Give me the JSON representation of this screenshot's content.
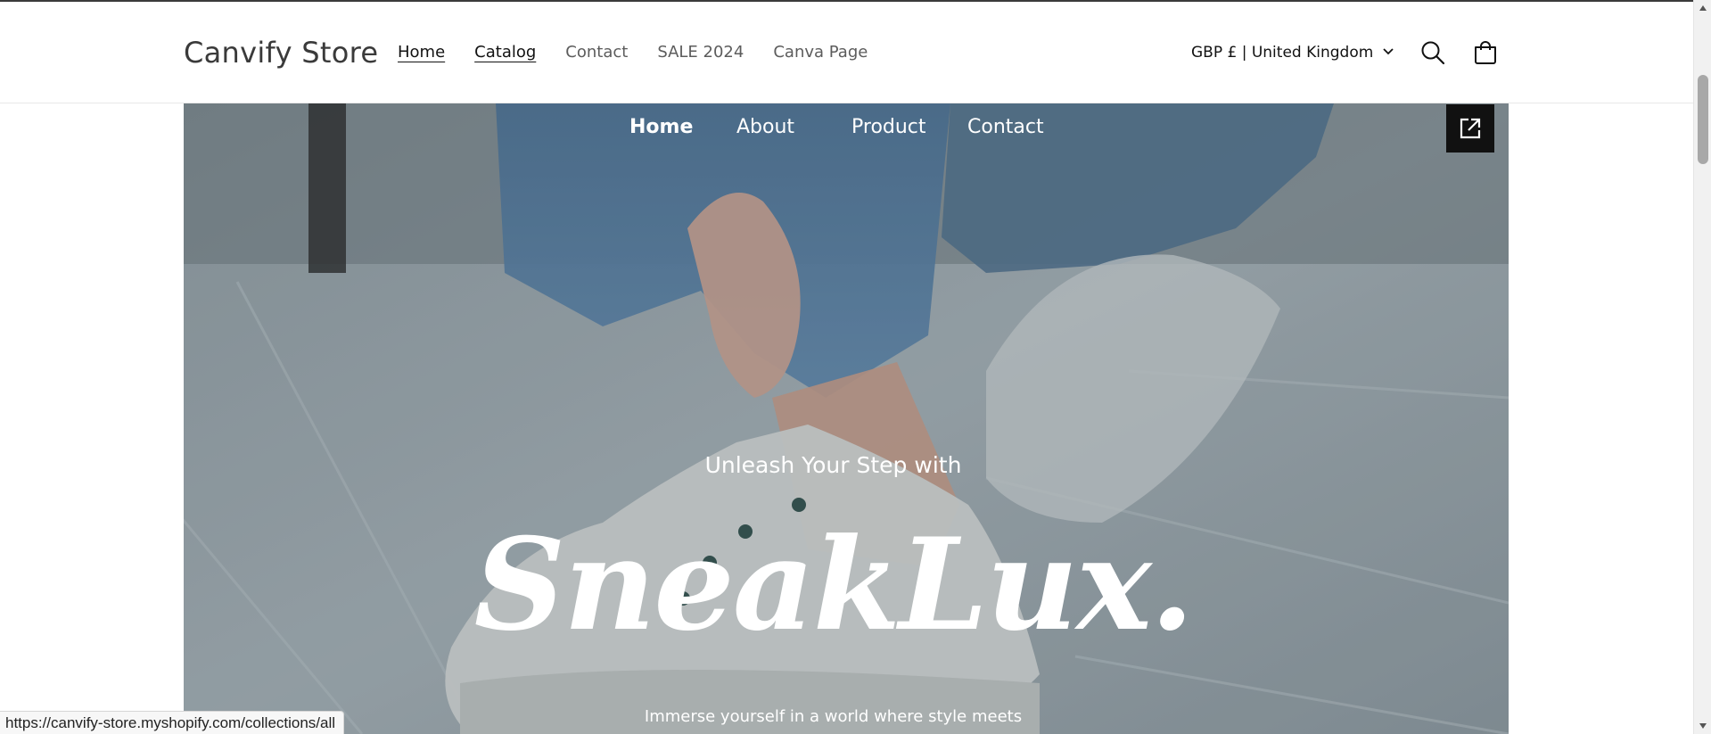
{
  "header": {
    "logo": "Canvify Store",
    "nav": [
      {
        "label": "Home",
        "active": true
      },
      {
        "label": "Catalog",
        "active": true
      },
      {
        "label": "Contact",
        "active": false
      },
      {
        "label": "SALE 2024",
        "active": false
      },
      {
        "label": "Canva Page",
        "active": false
      }
    ],
    "locale": "GBP £ | United Kingdom",
    "icons": [
      "search-icon",
      "cart-icon",
      "chevron-down-icon"
    ]
  },
  "hero": {
    "nav": [
      {
        "label": "Home"
      },
      {
        "label": "About"
      },
      {
        "label": "Product"
      },
      {
        "label": "Contact"
      }
    ],
    "tagline": "Unleash Your Step with",
    "brand": "SneakLux.",
    "description": "Immerse yourself in a world where style meets",
    "open_icon": "external-link-icon"
  },
  "status_url": "https://canvify-store.myshopify.com/collections/all",
  "colors": {
    "accent_dark": "#121212",
    "nav_muted": "#5c5c5c",
    "hero_overlay": "#7d8a92"
  }
}
